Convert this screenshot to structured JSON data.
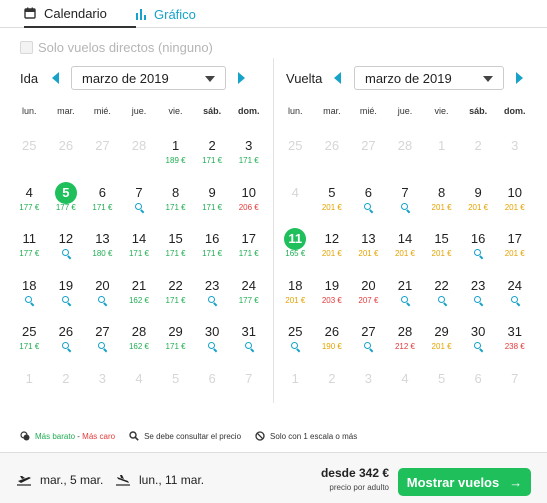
{
  "tabs": {
    "calendar": "Calendario",
    "graph": "Gráfico"
  },
  "direct_only": "Solo vuelos directos (ninguno)",
  "outbound": {
    "label": "Ida",
    "month": "marzo de 2019"
  },
  "return": {
    "label": "Vuelta",
    "month": "marzo de 2019"
  },
  "weekdays": [
    "lun.",
    "mar.",
    "mié.",
    "jue.",
    "vie.",
    "sáb.",
    "dom."
  ],
  "colors": {
    "accent": "#17a2c9",
    "green": "#1fbf5c",
    "cheap": "#1fae52",
    "mid": "#e5a300",
    "expensive": "#e33b3b"
  },
  "outbound_days": [
    {
      "d": "25",
      "dis": true
    },
    {
      "d": "26",
      "dis": true
    },
    {
      "d": "27",
      "dis": true
    },
    {
      "d": "28",
      "dis": true
    },
    {
      "d": "1",
      "p": "189 €",
      "c": "g"
    },
    {
      "d": "2",
      "p": "171 €",
      "c": "g"
    },
    {
      "d": "3",
      "p": "171 €",
      "c": "g"
    },
    {
      "d": "4",
      "p": "177 €",
      "c": "g"
    },
    {
      "d": "5",
      "p": "177 €",
      "c": "g",
      "sel": true
    },
    {
      "d": "6",
      "p": "171 €",
      "c": "g"
    },
    {
      "d": "7",
      "q": true
    },
    {
      "d": "8",
      "p": "171 €",
      "c": "g"
    },
    {
      "d": "9",
      "p": "171 €",
      "c": "g"
    },
    {
      "d": "10",
      "p": "206 €",
      "c": "r"
    },
    {
      "d": "11",
      "p": "177 €",
      "c": "g"
    },
    {
      "d": "12",
      "q": true
    },
    {
      "d": "13",
      "p": "180 €",
      "c": "g"
    },
    {
      "d": "14",
      "p": "171 €",
      "c": "g"
    },
    {
      "d": "15",
      "p": "171 €",
      "c": "g"
    },
    {
      "d": "16",
      "p": "171 €",
      "c": "g"
    },
    {
      "d": "17",
      "p": "171 €",
      "c": "g"
    },
    {
      "d": "18",
      "q": true
    },
    {
      "d": "19",
      "q": true
    },
    {
      "d": "20",
      "q": true
    },
    {
      "d": "21",
      "p": "162 €",
      "c": "g"
    },
    {
      "d": "22",
      "p": "171 €",
      "c": "g"
    },
    {
      "d": "23",
      "q": true
    },
    {
      "d": "24",
      "p": "177 €",
      "c": "g"
    },
    {
      "d": "25",
      "p": "171 €",
      "c": "g"
    },
    {
      "d": "26",
      "q": true
    },
    {
      "d": "27",
      "q": true
    },
    {
      "d": "28",
      "p": "162 €",
      "c": "g"
    },
    {
      "d": "29",
      "p": "171 €",
      "c": "g"
    },
    {
      "d": "30",
      "q": true
    },
    {
      "d": "31",
      "q": true
    },
    {
      "d": "1",
      "dis": true
    },
    {
      "d": "2",
      "dis": true
    },
    {
      "d": "3",
      "dis": true
    },
    {
      "d": "4",
      "dis": true
    },
    {
      "d": "5",
      "dis": true
    },
    {
      "d": "6",
      "dis": true
    },
    {
      "d": "7",
      "dis": true
    }
  ],
  "return_days": [
    {
      "d": "25",
      "dis": true
    },
    {
      "d": "26",
      "dis": true
    },
    {
      "d": "27",
      "dis": true
    },
    {
      "d": "28",
      "dis": true
    },
    {
      "d": "1",
      "dis": true
    },
    {
      "d": "2",
      "dis": true
    },
    {
      "d": "3",
      "dis": true
    },
    {
      "d": "4",
      "dis": true
    },
    {
      "d": "5",
      "p": "201 €",
      "c": "o"
    },
    {
      "d": "6",
      "q": true
    },
    {
      "d": "7",
      "q": true
    },
    {
      "d": "8",
      "p": "201 €",
      "c": "o"
    },
    {
      "d": "9",
      "p": "201 €",
      "c": "o"
    },
    {
      "d": "10",
      "p": "201 €",
      "c": "o"
    },
    {
      "d": "11",
      "p": "165 €",
      "c": "g",
      "sel": true
    },
    {
      "d": "12",
      "p": "201 €",
      "c": "o"
    },
    {
      "d": "13",
      "p": "201 €",
      "c": "o"
    },
    {
      "d": "14",
      "p": "201 €",
      "c": "o"
    },
    {
      "d": "15",
      "p": "201 €",
      "c": "o"
    },
    {
      "d": "16",
      "q": true
    },
    {
      "d": "17",
      "p": "201 €",
      "c": "o"
    },
    {
      "d": "18",
      "p": "201 €",
      "c": "o"
    },
    {
      "d": "19",
      "p": "203 €",
      "c": "r"
    },
    {
      "d": "20",
      "p": "207 €",
      "c": "r"
    },
    {
      "d": "21",
      "q": true
    },
    {
      "d": "22",
      "q": true
    },
    {
      "d": "23",
      "q": true
    },
    {
      "d": "24",
      "q": true
    },
    {
      "d": "25",
      "q": true
    },
    {
      "d": "26",
      "p": "190 €",
      "c": "o"
    },
    {
      "d": "27",
      "q": true
    },
    {
      "d": "28",
      "p": "212 €",
      "c": "r"
    },
    {
      "d": "29",
      "p": "201 €",
      "c": "o"
    },
    {
      "d": "30",
      "q": true
    },
    {
      "d": "31",
      "p": "238 €",
      "c": "r"
    },
    {
      "d": "1",
      "dis": true
    },
    {
      "d": "2",
      "dis": true
    },
    {
      "d": "3",
      "dis": true
    },
    {
      "d": "4",
      "dis": true
    },
    {
      "d": "5",
      "dis": true
    },
    {
      "d": "6",
      "dis": true
    },
    {
      "d": "7",
      "dis": true
    }
  ],
  "legend": {
    "cheap": "Más barato",
    "sep": "-",
    "expensive": "Más caro",
    "consult": "Se debe consultar el precio",
    "one_stop": "Solo con 1 escala o más"
  },
  "footer": {
    "depart": "mar., 5 mar.",
    "return": "lun., 11 mar.",
    "price": "desde 342 €",
    "per": "precio por adulto",
    "button": "Mostrar vuelos",
    "arrow": "→"
  }
}
